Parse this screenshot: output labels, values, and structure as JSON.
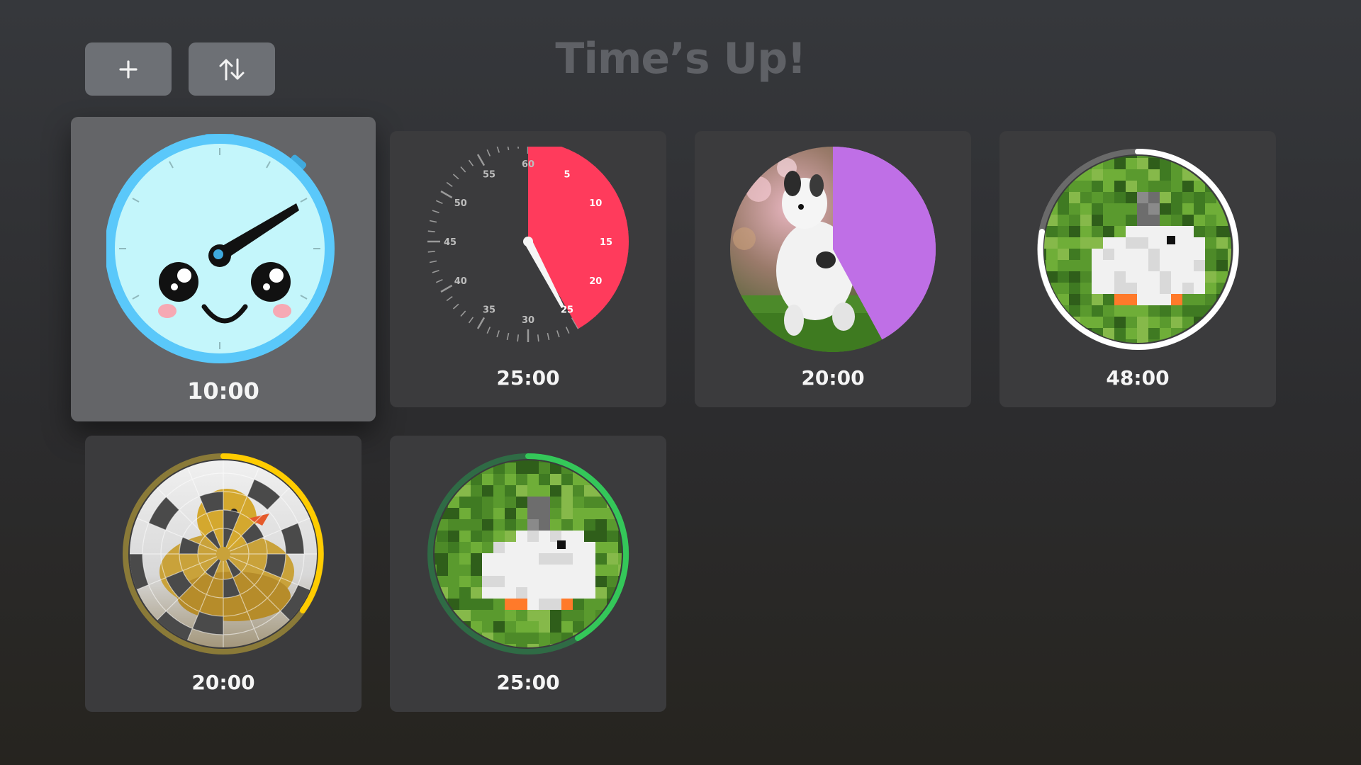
{
  "app": {
    "title": "Time’s Up!"
  },
  "toolbar": {
    "add_icon": "plus-icon",
    "sort_icon": "sort-arrows-icon"
  },
  "timers": [
    {
      "time": "10:00",
      "style": "kawaii-stopwatch",
      "focused": true,
      "accent": "#5ac8fa"
    },
    {
      "time": "25:00",
      "style": "red-dial-clock",
      "accent": "#ff3b5c",
      "dial_labels": [
        "60",
        "5",
        "10",
        "15",
        "20",
        "25",
        "30",
        "35",
        "40",
        "45",
        "50",
        "55"
      ]
    },
    {
      "time": "20:00",
      "style": "photo-pie-reveal",
      "accent": "#bf6fe6"
    },
    {
      "time": "48:00",
      "style": "pixelated-photo-ring",
      "accent": "#ffffff"
    },
    {
      "time": "20:00",
      "style": "jigsaw-puzzle-ring",
      "accent": "#ffcc00"
    },
    {
      "time": "25:00",
      "style": "pixelated-photo-ring",
      "accent": "#34c759"
    }
  ],
  "colors": {
    "card": "#3b3b3d",
    "card_focused": "#646568",
    "title": "#5f6166",
    "button": "#6d7075"
  }
}
